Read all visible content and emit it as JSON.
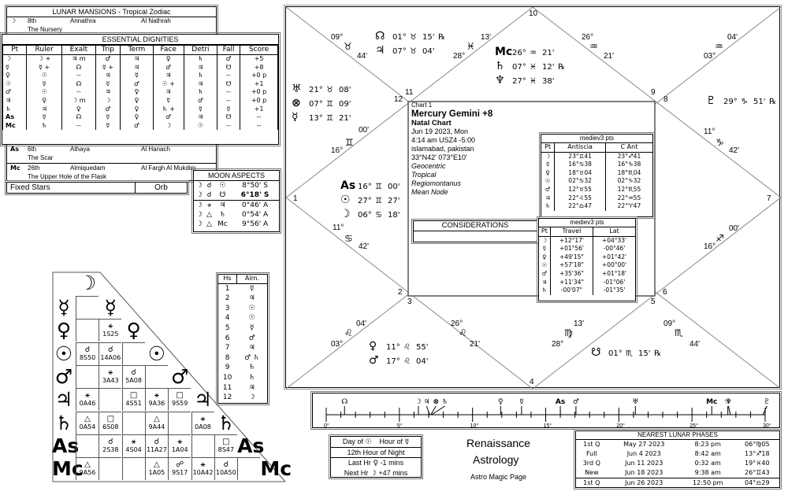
{
  "lunar_mansions": {
    "title": "LUNAR MANSIONS - Tropical Zodiac",
    "rows": [
      {
        "glyph": "☽",
        "num": "8th",
        "name": "Annathra",
        "arabic": "Al Nathrah",
        "meaning": "The Nursery"
      },
      {
        "glyph": "As",
        "num": "6th",
        "name": "Athaya",
        "arabic": "Al Hanach",
        "meaning": "The Scar"
      },
      {
        "glyph": "Mc",
        "num": "26th",
        "name": "Almiquedam",
        "arabic": "Al Fargh Al Mukdim",
        "meaning": "The Upper Hole of the Flask"
      }
    ]
  },
  "essential_dignities": {
    "title": "ESSENTIAL DIGNITIES",
    "headers": [
      "Pt",
      "Ruler",
      "Exalt",
      "Trip",
      "Term",
      "Face",
      "Detri",
      "Fall",
      "Score"
    ],
    "rows": [
      [
        "☽",
        "☽ +",
        "♃ m",
        "♂",
        "♃",
        "♀",
        "♄",
        "♂",
        "+5"
      ],
      [
        "☿",
        "☿ +",
        "☊",
        "☿ +",
        "♃",
        "♂",
        "♃",
        "☋",
        "+8"
      ],
      [
        "♀",
        "☉",
        "--",
        "♃",
        "☿",
        "♃",
        "♄",
        "--",
        "+0 p"
      ],
      [
        "☉",
        "☿",
        "☊",
        "☿",
        "♂",
        "☉ +",
        "♃",
        "☋",
        "+1"
      ],
      [
        "♂",
        "☉",
        "--",
        "♃",
        "♀",
        "♃",
        "♄",
        "--",
        "+0 p"
      ],
      [
        "♃",
        "♀",
        "☽ m",
        "☽",
        "♀",
        "☿",
        "♂",
        "--",
        "+0 p"
      ],
      [
        "♄",
        "♃",
        "♀",
        "♂",
        "♀",
        "♄ +",
        "☿",
        "☿",
        "+1"
      ],
      [
        "As",
        "☿",
        "☊",
        "☿",
        "♀",
        "♂",
        "♃",
        "☋",
        "--"
      ],
      [
        "Mc",
        "♄",
        "--",
        "☿",
        "♂",
        "☽",
        "☉",
        "--",
        "--"
      ]
    ]
  },
  "fixed_stars": {
    "label": "Fixed Stars",
    "orb_label": "Orb"
  },
  "moon_aspects": {
    "title": "MOON ASPECTS",
    "rows": [
      [
        "☽",
        "☌",
        "☉",
        "8°50' S",
        false
      ],
      [
        "☽",
        "☌",
        "☋",
        "6°18' S",
        true
      ],
      [
        "☽",
        "⚹",
        "♃",
        "0°46' A",
        false
      ],
      [
        "☽",
        "△",
        "♄",
        "0°54' A",
        false
      ],
      [
        "☽",
        "△",
        "Mc",
        "9°56' A",
        false
      ]
    ]
  },
  "aspect_grid": {
    "planets": [
      "☽",
      "☿",
      "♀",
      "☉",
      "♂",
      "♃",
      "♄",
      "As",
      "Mc"
    ],
    "rows": [
      [
        ""
      ],
      [
        "",
        "⚹|1S25"
      ],
      [
        "☌|8S50",
        "☌|14A06",
        ""
      ],
      [
        "",
        "⚹|3A43",
        "☌|5A08",
        ""
      ],
      [
        "⚹|0A46",
        "",
        "□|4S51",
        "⚹|9A36",
        "□|9S59"
      ],
      [
        "△|0A54",
        "□|6S08",
        "",
        "△|9A44",
        "",
        "⚹|0A08"
      ],
      [
        "",
        "☌|2S38",
        "⚹|4S04",
        "☌|11A27",
        "⚹|1A04",
        "",
        "□|8S47"
      ],
      [
        "△|9A56",
        "",
        "",
        "△|1A05",
        "☍|9S17",
        "⚹|10A42",
        "☌|10A50",
        ""
      ]
    ]
  },
  "almutens": {
    "headers": [
      "Hs",
      "Alm."
    ],
    "rows": [
      [
        "1",
        "☿"
      ],
      [
        "2",
        "♃"
      ],
      [
        "3",
        "☉"
      ],
      [
        "4",
        "☉"
      ],
      [
        "5",
        "☿"
      ],
      [
        "6",
        "♂"
      ],
      [
        "7",
        "♃"
      ],
      [
        "8",
        "♂ ♄"
      ],
      [
        "9",
        "♄"
      ],
      [
        "10",
        "♄"
      ],
      [
        "11",
        "♃"
      ],
      [
        "12",
        "☽"
      ]
    ]
  },
  "chart": {
    "name_label": "Chart 1",
    "title": "Mercury Gemini +8",
    "type": "Natal Chart",
    "date": "Jun 19 2023, Mon",
    "time": "4:14 am  USZ4 -5:00",
    "place": "islamabad, pakistan",
    "coords": "33°N42' 073°E10'",
    "options": [
      "Geocentric",
      "Tropical",
      "Regiomontanus",
      "Mean Node"
    ],
    "house_numbers": [
      "1",
      "2",
      "3",
      "4",
      "5",
      "6",
      "7",
      "8",
      "9",
      "10",
      "11",
      "12"
    ],
    "cusps": [
      [
        "16°",
        "♊",
        "00'"
      ],
      [
        "03°",
        "♌",
        "04'"
      ],
      [
        "26°",
        "♌",
        "21'"
      ],
      [
        "28°",
        "♍",
        "13'"
      ],
      [
        "09°",
        "♏",
        "44'"
      ],
      [
        "16°",
        "♐",
        "00'"
      ],
      [
        "11°",
        "♑",
        "42'"
      ],
      [
        "03°",
        "♒",
        "04'"
      ],
      [
        "26°",
        "♒",
        "21'"
      ],
      [
        "28°",
        "♓",
        "13'"
      ],
      [
        "09°",
        "♉",
        "44'"
      ],
      [
        "11°",
        "♋",
        "42'"
      ]
    ],
    "planet_groups": [
      [
        [
          "☊",
          "01°",
          "♉",
          "15'",
          "℞"
        ],
        [
          "♃",
          "07°",
          "♉",
          "04'",
          ""
        ]
      ],
      [
        [
          "Mc",
          "26°",
          "♒",
          "21'",
          ""
        ],
        [
          "♄",
          "07°",
          "♓",
          "12'",
          "℞"
        ],
        [
          "♆",
          "27°",
          "♓",
          "38'",
          ""
        ]
      ],
      [
        [
          "♅",
          "21°",
          "♉",
          "08'",
          ""
        ],
        [
          "⊗",
          "07°",
          "♊",
          "09'",
          ""
        ],
        [
          "☿",
          "13°",
          "♊",
          "21'",
          ""
        ]
      ],
      [
        [
          "♇",
          "29°",
          "♑",
          "51'",
          "℞"
        ]
      ],
      [
        [
          "As",
          "16°",
          "♊",
          "00'",
          ""
        ],
        [
          "☉",
          "27°",
          "♊",
          "27'",
          ""
        ],
        [
          "☽",
          "06°",
          "♋",
          "18'",
          ""
        ]
      ],
      [
        [
          "♀",
          "11°",
          "♌",
          "55'",
          ""
        ],
        [
          "♂",
          "17°",
          "♌",
          "04'",
          ""
        ]
      ],
      [
        [
          "☋",
          "01°",
          "♏",
          "15'",
          "℞"
        ]
      ]
    ]
  },
  "considerations": {
    "title": "CONSIDERATIONS"
  },
  "antiscia": {
    "title": "mediev3 pts",
    "headers": [
      "Pt",
      "Antiscia",
      "C Ant"
    ],
    "rows": [
      [
        "☽",
        "23°♊41",
        "23°♐41"
      ],
      [
        "☿",
        "16°♋38",
        "16°♑38"
      ],
      [
        "♀",
        "18°♉04",
        "18°♏04"
      ],
      [
        "☉",
        "02°♋32",
        "02°♑32"
      ],
      [
        "♂",
        "12°♉55",
        "12°♏55"
      ],
      [
        "♃",
        "22°♌55",
        "22°♒55"
      ],
      [
        "♄",
        "22°♎47",
        "22°♈47"
      ]
    ]
  },
  "travel": {
    "title": "mediev3 pts",
    "headers": [
      "Pt",
      "Travel",
      "Lat"
    ],
    "rows": [
      [
        "☽",
        "+12°17'",
        "+04°33'"
      ],
      [
        "☿",
        "+01°56'",
        "-00°46'"
      ],
      [
        "♀",
        "+49'15\"",
        "+01°42'"
      ],
      [
        "☉",
        "+57'18\"",
        "+00°00'"
      ],
      [
        "♂",
        "+35'36\"",
        "+01°18'"
      ],
      [
        "♃",
        "+11'34\"",
        "-01°06'"
      ],
      [
        "♄",
        "-00'07\"",
        "-01°35'"
      ]
    ]
  },
  "degree_ruler": {
    "range": [
      0,
      30
    ],
    "tick_labels": [
      "0°",
      "5°",
      "10°",
      "15°",
      "20°",
      "25°",
      "30°"
    ],
    "markers": [
      [
        "☊",
        1.25
      ],
      [
        "☽",
        6.3
      ],
      [
        "♃",
        7.07
      ],
      [
        "⊗",
        7.15
      ],
      [
        "♄",
        7.2
      ],
      [
        "♀",
        11.92
      ],
      [
        "☿",
        13.35
      ],
      [
        "As",
        16.0
      ],
      [
        "♂",
        17.07
      ],
      [
        "♅",
        21.13
      ],
      [
        "Mc",
        26.35
      ],
      [
        "☉",
        27.45
      ],
      [
        "♆",
        27.63
      ],
      [
        "♇",
        29.85
      ]
    ]
  },
  "planetary_hour": {
    "day_of_label": "Day of",
    "day_glyph": "☉",
    "hour_of_label": "Hour of",
    "hour_glyph": "☿",
    "current": "12th Hour of Night",
    "last_label": "Last Hr",
    "last_glyph": "♀",
    "last_value": "-1 mins",
    "next_label": "Next Hr",
    "next_glyph": "☽",
    "next_value": "+47 mins"
  },
  "branding": {
    "line1": "Renaissance",
    "line2": "Astrology",
    "line3": "Astro Magic Page"
  },
  "lunar_phases": {
    "title": "NEAREST LUNAR PHASES",
    "rows": [
      [
        "1st Q",
        "May 27 2023",
        "8:23 pm",
        "06°♍05"
      ],
      [
        "Full",
        "Jun 4 2023",
        "8:42 am",
        "13°♐18"
      ],
      [
        "3rd Q",
        "Jun 11 2023",
        "0:32 am",
        "19°♓40"
      ],
      [
        "New",
        "Jun 18 2023",
        "9:38 am",
        "26°♊43"
      ],
      [
        "1st Q",
        "Jun 26 2023",
        "12:50 pm",
        "04°♎29"
      ]
    ]
  }
}
